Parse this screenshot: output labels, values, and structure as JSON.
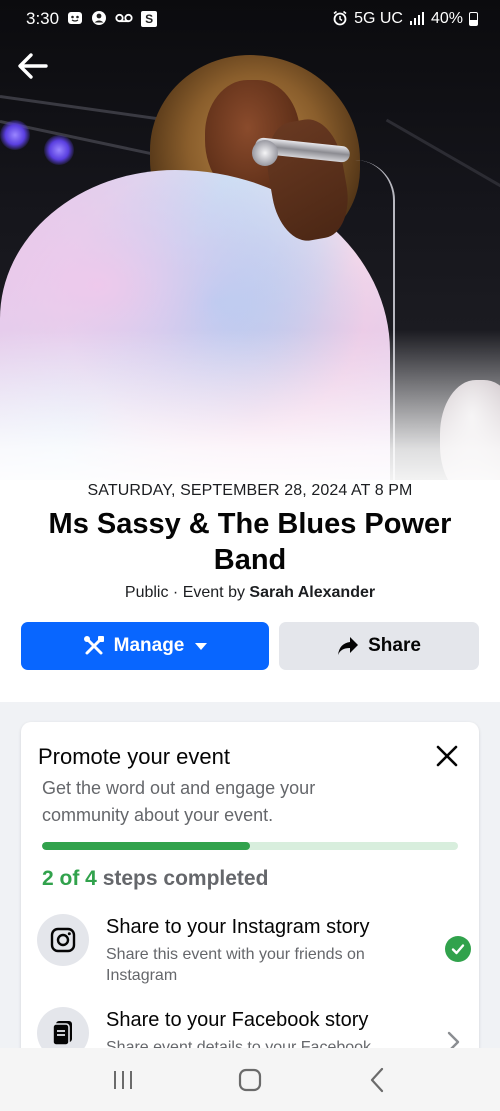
{
  "status_bar": {
    "time": "3:30",
    "network": "5G UC",
    "battery": "40%"
  },
  "event": {
    "date": "SATURDAY, SEPTEMBER 28, 2024 AT 8 PM",
    "title": "Ms Sassy & The Blues Power Band",
    "privacy": "Public",
    "separator": " · ",
    "host_prefix": "Event by ",
    "host": "Sarah Alexander"
  },
  "actions": {
    "manage_label": "Manage",
    "share_label": "Share"
  },
  "promote": {
    "title": "Promote your event",
    "description": "Get the word out and engage your community about your event.",
    "progress": 0.5,
    "steps_completed": "2 of 4",
    "steps_suffix": " steps completed",
    "items": [
      {
        "title": "Share to your Instagram story",
        "description": "Share this event with your friends on Instagram",
        "icon": "instagram-icon",
        "completed": true
      },
      {
        "title": "Share to your Facebook story",
        "description": "Share event details to your Facebook story",
        "icon": "story-icon",
        "completed": false
      }
    ]
  },
  "colors": {
    "primary": "#0866ff",
    "success": "#31a24c",
    "secondary_bg": "#e4e6eb"
  }
}
